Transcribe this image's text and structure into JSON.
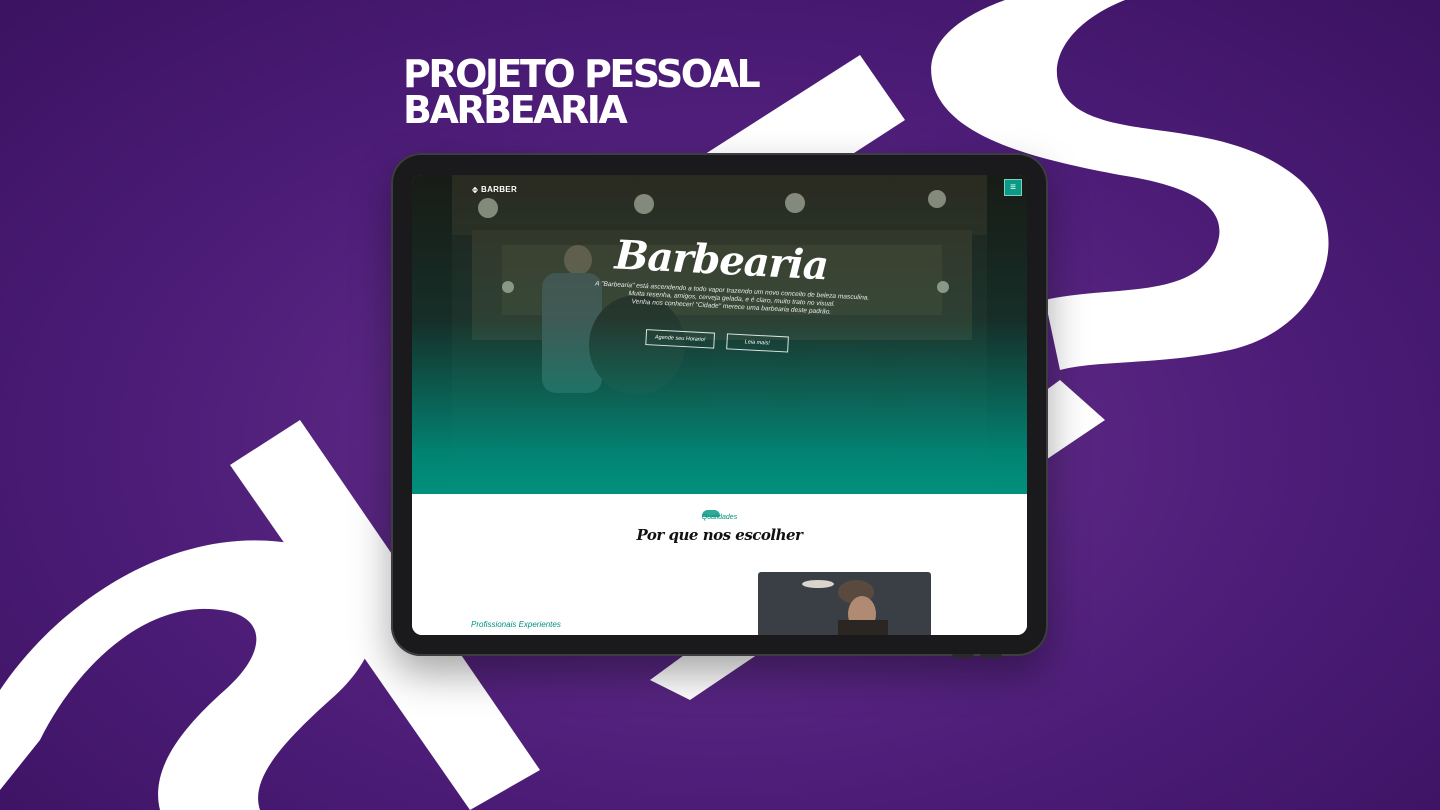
{
  "headline": {
    "line1": "PROJETO PESSOAL",
    "line2": "BARBEARIA"
  },
  "background": {
    "color": "#4d1d78",
    "decoration_color": "#ffffff"
  },
  "site": {
    "logo": {
      "icon": "barber-logo-icon",
      "text": "BARBER"
    },
    "menu_icon": "hamburger-menu-icon",
    "menu_symbol": "≡",
    "hero": {
      "title": "Barbearia",
      "description_lines": [
        "A \"Barbearia\" está ascendendo a todo vapor trazendo um novo conceito de beleza masculina.",
        "Muita resenha, amigos, cerveja gelada, e é claro, muito trato no visual.",
        "Venha nos conhecer! \"Cidade\" merece uma barbearia deste padrão."
      ],
      "buttons": [
        {
          "label": "Agende seu Horario!"
        },
        {
          "label": "Leia mais!"
        }
      ]
    },
    "qualities": {
      "eyebrow": "Qualidades",
      "title": "Por que nos escolher",
      "item": "Profissionais Experientes"
    },
    "accent_color": "#00917d"
  }
}
